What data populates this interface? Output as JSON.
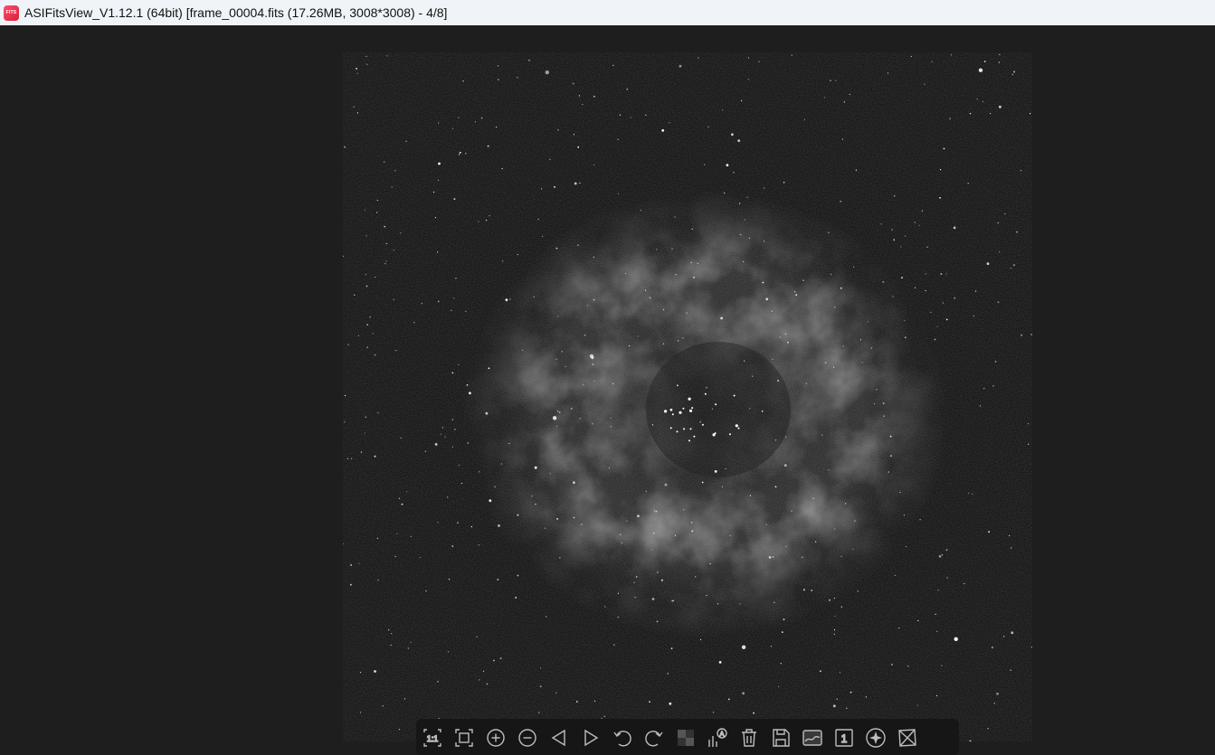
{
  "window": {
    "app_icon_text": "FITS",
    "title": "ASIFitsView_V1.12.1 (64bit) [frame_00004.fits (17.26MB, 3008*3008) - 4/8]"
  },
  "image": {
    "subject": "nebula"
  },
  "toolbar": {
    "tools": [
      {
        "name": "actual-size",
        "icon": "one-to-one-icon",
        "label": "1:1"
      },
      {
        "name": "fit-to-window",
        "icon": "fit-window-icon"
      },
      {
        "name": "zoom-in",
        "icon": "zoom-in-icon"
      },
      {
        "name": "zoom-out",
        "icon": "zoom-out-icon"
      },
      {
        "name": "previous-image",
        "icon": "triangle-left-icon"
      },
      {
        "name": "next-image",
        "icon": "triangle-right-icon"
      },
      {
        "name": "rotate-left",
        "icon": "rotate-ccw-icon"
      },
      {
        "name": "rotate-right",
        "icon": "rotate-cw-icon"
      },
      {
        "name": "debayer",
        "icon": "checker-icon"
      },
      {
        "name": "auto-stretch",
        "icon": "histogram-auto-icon",
        "label": "A"
      },
      {
        "name": "delete",
        "icon": "trash-icon"
      },
      {
        "name": "save",
        "icon": "save-icon"
      },
      {
        "name": "image-info",
        "icon": "image-thumb-icon"
      },
      {
        "name": "single-frame",
        "icon": "frame-one-icon",
        "label": "1"
      },
      {
        "name": "star-detect",
        "icon": "star-circle-icon"
      },
      {
        "name": "crop",
        "icon": "crop-icon"
      }
    ]
  }
}
